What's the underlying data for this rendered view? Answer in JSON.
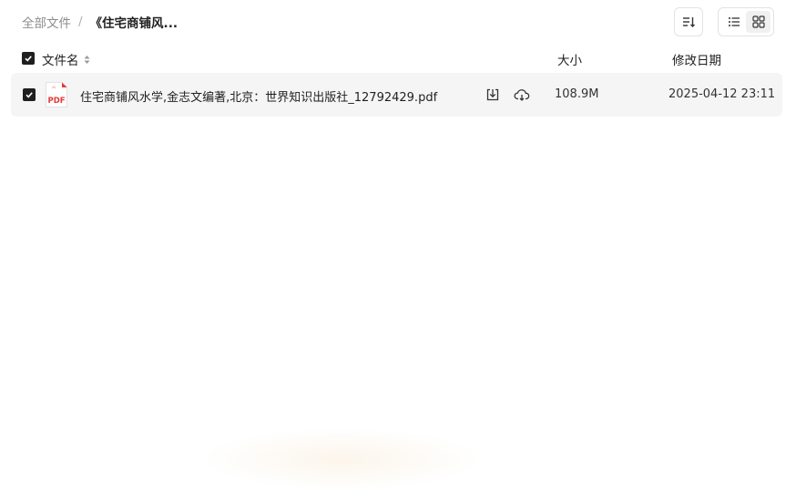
{
  "breadcrumb": {
    "root": "全部文件",
    "separator": "/",
    "current": "《住宅商铺风..."
  },
  "toolbar": {
    "sort_icon": "sort-descending-icon",
    "view_list_icon": "list-view-icon",
    "view_grid_icon": "grid-view-icon"
  },
  "table": {
    "headers": {
      "name": "文件名",
      "size": "大小",
      "date": "修改日期"
    },
    "rows": [
      {
        "checked": true,
        "type_label": "PDF",
        "name": "住宅商铺风水学,金志文编著,北京：世界知识出版社_12792429.pdf",
        "size": "108.9M",
        "modified": "2025-04-12 23:11"
      }
    ]
  },
  "colors": {
    "row_bg": "#f5f5f5",
    "pdf_red": "#e53935",
    "checkbox": "#1f1f1f"
  }
}
